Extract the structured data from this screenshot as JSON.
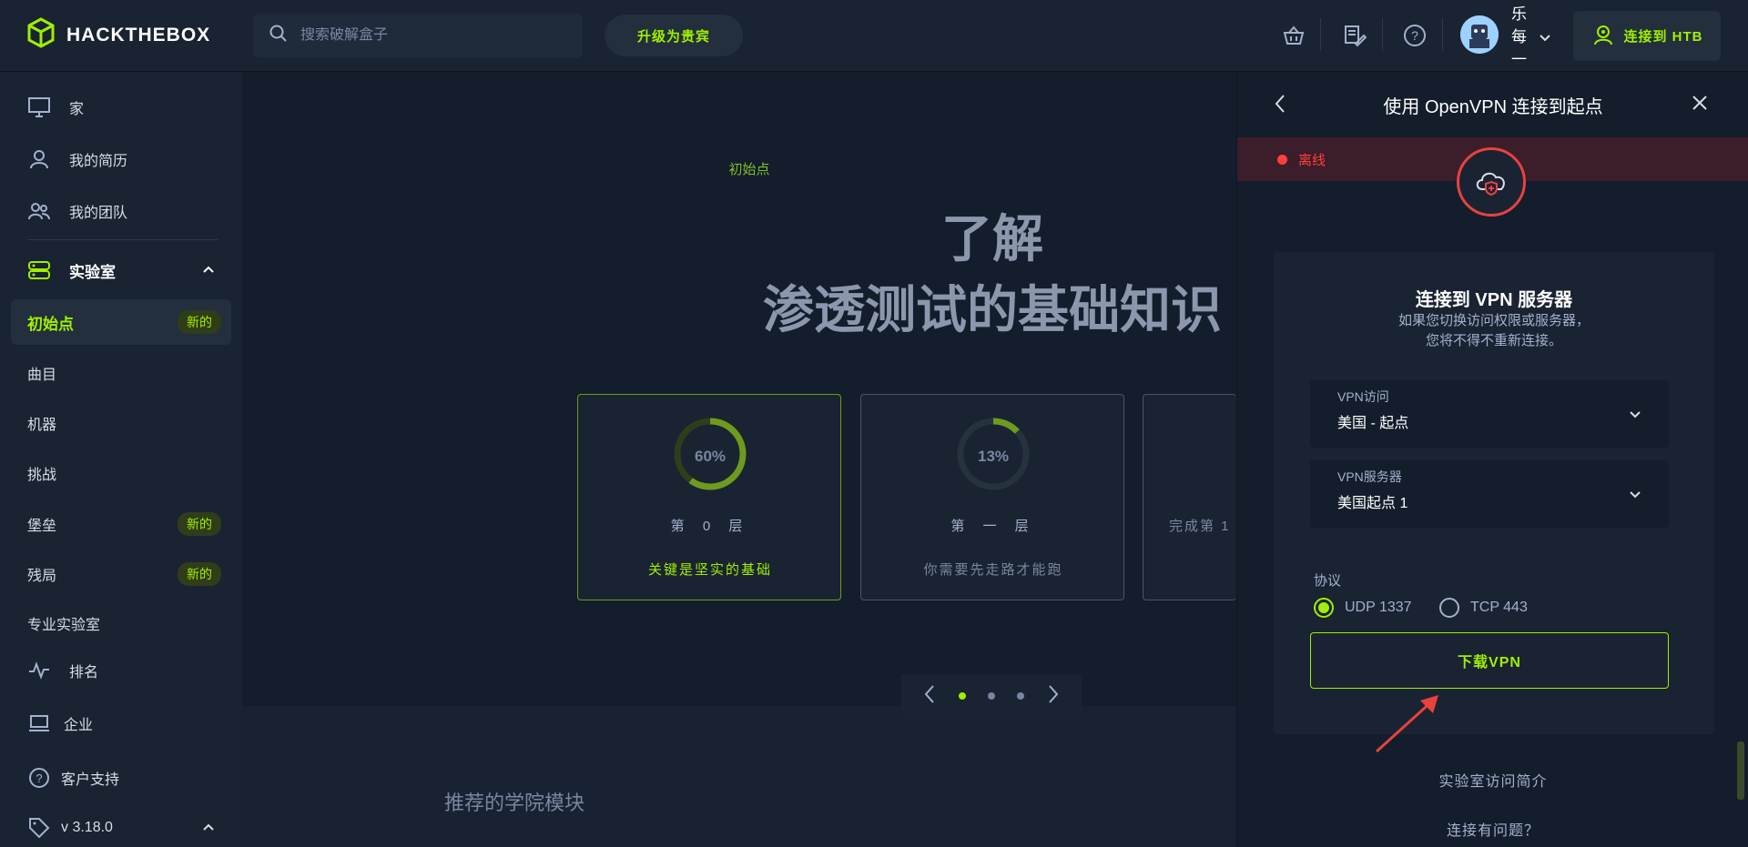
{
  "header": {
    "logo_text": "HACKTHEBOX",
    "search_placeholder": "搜索破解盒子",
    "upgrade_label": "升级为贵宾",
    "username": "乐每一",
    "connect_label": "连接到 HTB",
    "icons": [
      "basket-icon",
      "notes-icon",
      "help-icon",
      "chevron-down-icon"
    ]
  },
  "sidebar": {
    "items": [
      {
        "label": "家",
        "icon": "monitor-icon"
      },
      {
        "label": "我的简历",
        "icon": "user-icon"
      },
      {
        "label": "我的团队",
        "icon": "team-icon"
      },
      {
        "label": "实验室",
        "icon": "server-icon"
      },
      {
        "label": "初始点",
        "badge": "新的"
      },
      {
        "label": "曲目"
      },
      {
        "label": "机器"
      },
      {
        "label": "挑战"
      },
      {
        "label": "堡垒",
        "badge": "新的"
      },
      {
        "label": "残局",
        "badge": "新的"
      },
      {
        "label": "专业实验室"
      },
      {
        "label": "排名",
        "icon": "pulse-icon"
      },
      {
        "label": "企业",
        "icon": "laptop-icon"
      },
      {
        "label": "客户支持",
        "icon": "question-icon"
      },
      {
        "label": "v 3.18.0",
        "icon": "tag-icon"
      }
    ]
  },
  "main": {
    "tag": "初始点",
    "hero_line1": "了解",
    "hero_line2": "渗透测试的基础知识",
    "cards": [
      {
        "progress": "60%",
        "level": "第 0 层",
        "desc": "关键是坚实的基础"
      },
      {
        "progress": "13%",
        "level": "第 一 层",
        "desc": "你需要先走路才能跑"
      },
      {
        "progress": "",
        "level": "完成第 1",
        "desc": ""
      }
    ],
    "section_title": "推荐的学院模块"
  },
  "panel": {
    "title": "使用 OpenVPN 连接到起点",
    "status": "离线",
    "card_title": "连接到 VPN 服务器",
    "card_sub1": "如果您切换访问权限或服务器，",
    "card_sub2": "您将不得不重新连接。",
    "access_label": "VPN访问",
    "access_value": "美国 - 起点",
    "server_label": "VPN服务器",
    "server_value": "美国起点 1",
    "protocol_label": "协议",
    "udp_label": "UDP 1337",
    "tcp_label": "TCP 443",
    "download_label": "下载VPN",
    "link_intro": "实验室访问简介",
    "link_problem": "连接有问题？"
  },
  "colors": {
    "accent": "#9fef00",
    "danger": "#ff3e3e",
    "bg": "#141d2b",
    "surface": "#1a2332"
  }
}
